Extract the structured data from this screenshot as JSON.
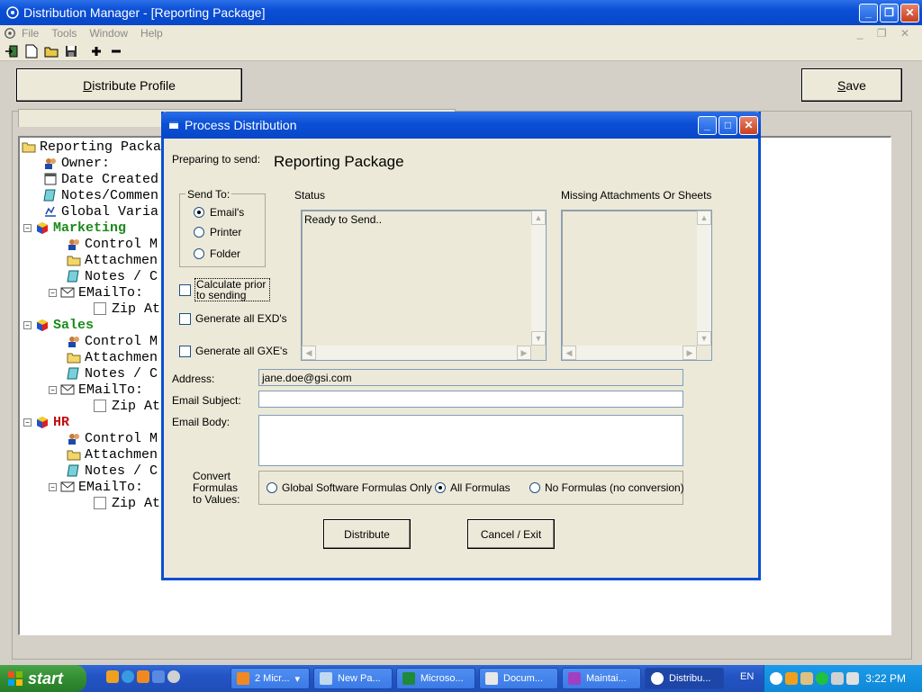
{
  "window": {
    "title": "Distribution Manager - [Reporting Package]"
  },
  "menu": {
    "items": [
      "File",
      "Tools",
      "Window",
      "Help"
    ]
  },
  "toolbar": {
    "icons": [
      "exit-icon",
      "new-file-icon",
      "open-folder-icon",
      "save-disk-icon",
      "plus-icon",
      "minus-icon"
    ]
  },
  "main": {
    "distribute_profile_label": "Distribute Profile",
    "save_label_prefix": "",
    "save_label_u": "S",
    "save_label_rest": "ave",
    "dist_u": "D",
    "dist_rest": "istribute Profile"
  },
  "tree": {
    "root": "Reporting Packa",
    "owner": "Owner:",
    "date_created": "Date Created",
    "notes": "Notes/Commen",
    "global_vars": "Global Varia",
    "groups": [
      {
        "name": "Marketing",
        "control": "Control M",
        "attach": "Attachmen",
        "notes": "Notes / C",
        "email": "EMailTo:",
        "zip": "Zip At"
      },
      {
        "name": "Sales",
        "control": "Control M",
        "attach": "Attachmen",
        "notes": "Notes / C",
        "email": "EMailTo:",
        "zip": "Zip At"
      },
      {
        "name": "HR",
        "control": "Control M",
        "attach": "Attachmen",
        "notes": "Notes / C",
        "email": "EMailTo:",
        "zip": "Zip At"
      }
    ]
  },
  "dialog": {
    "title": "Process Distribution",
    "preparing_label": "Preparing to send:",
    "package_name": "Reporting Package",
    "send_to_label": "Send To:",
    "send_options": [
      "Email's",
      "Printer",
      "Folder"
    ],
    "calc_label": "Calculate prior to sending",
    "exd_label": "Generate all EXD's",
    "gxe_label": "Generate all GXE's",
    "status_label": "Status",
    "status_text": "Ready to Send..",
    "missing_label": "Missing Attachments Or Sheets",
    "address_label": "Address:",
    "address_value": "jane.doe@gsi.com",
    "subject_label": "Email Subject:",
    "subject_value": "",
    "body_label": "Email Body:",
    "body_value": "",
    "convert_label": "Convert Formulas to Values:",
    "formula_options": [
      "Global Software Formulas Only",
      "All Formulas",
      "No Formulas (no conversion)"
    ],
    "distribute_label": "Distribute",
    "cancel_label": "Cancel / Exit"
  },
  "taskbar": {
    "start_label": "start",
    "items": [
      "2 Micr...",
      "New Pa...",
      "Microso...",
      "Docum...",
      "Maintai...",
      "Distribu..."
    ],
    "lang": "EN",
    "clock": "3:22 PM"
  }
}
